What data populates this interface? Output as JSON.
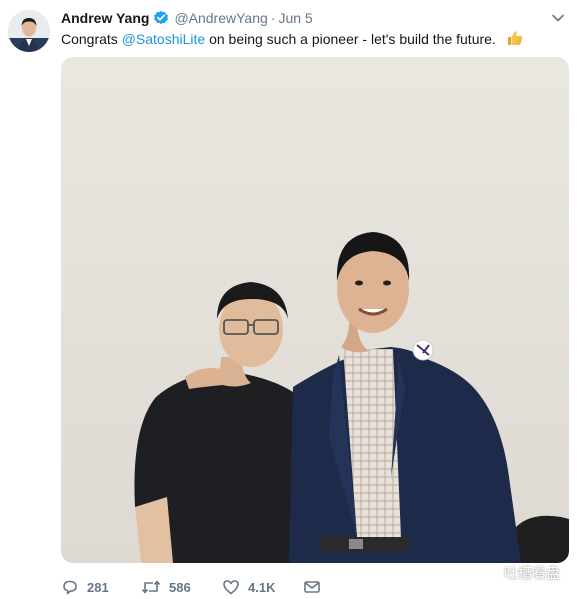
{
  "tweet": {
    "author_name": "Andrew Yang",
    "handle": "@AndrewYang",
    "separator": "·",
    "date": "Jun 5",
    "text_before": "Congrats ",
    "mention": "@SatoshiLite",
    "text_after": " on being such a pioneer - let's build the future.",
    "emoji_icon": "thumbs-up-icon"
  },
  "actions": {
    "reply_count": "281",
    "retweet_count": "586",
    "like_count": "4.1K"
  },
  "watermark": {
    "text": "吐槽看盘"
  },
  "colors": {
    "link": "#1b95e0",
    "secondary": "#657786",
    "verified": "#1da1f2"
  }
}
